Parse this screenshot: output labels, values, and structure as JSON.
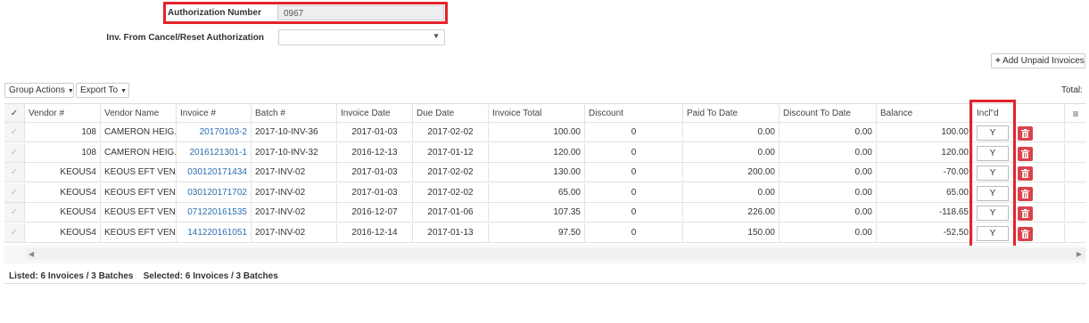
{
  "form": {
    "auth_label": "Authorization Number",
    "auth_value": "0967",
    "inv_cancel_label": "Inv. From Cancel/Reset Authorization",
    "inv_cancel_value": ""
  },
  "toolbar": {
    "add_unpaid_label": "Add Unpaid Invoices",
    "group_actions_label": "Group Actions",
    "export_to_label": "Export To",
    "total_label": "Total:"
  },
  "grid": {
    "columns": [
      "Vendor #",
      "Vendor Name",
      "Invoice #",
      "Batch #",
      "Invoice Date",
      "Due Date",
      "Invoice Total",
      "Discount",
      "Paid To Date",
      "Discount To Date",
      "Balance",
      "Incl\"d"
    ],
    "rows": [
      {
        "vendor": "108",
        "name": "CAMERON HEIG...",
        "invoice": "20170103-2",
        "batch": "2017-10-INV-36",
        "inv_date": "2017-01-03",
        "due_date": "2017-02-02",
        "total": "100.00",
        "discount": "0",
        "paid": "0.00",
        "disc_to_date": "0.00",
        "balance": "100.00",
        "incl": "Y"
      },
      {
        "vendor": "108",
        "name": "CAMERON HEIG...",
        "invoice": "2016121301-1",
        "batch": "2017-10-INV-32",
        "inv_date": "2016-12-13",
        "due_date": "2017-01-12",
        "total": "120.00",
        "discount": "0",
        "paid": "0.00",
        "disc_to_date": "0.00",
        "balance": "120.00",
        "incl": "Y"
      },
      {
        "vendor": "KEOUS4",
        "name": "KEOUS EFT VEN...",
        "invoice": "030120171434",
        "batch": "2017-INV-02",
        "inv_date": "2017-01-03",
        "due_date": "2017-02-02",
        "total": "130.00",
        "discount": "0",
        "paid": "200.00",
        "disc_to_date": "0.00",
        "balance": "-70.00",
        "incl": "Y"
      },
      {
        "vendor": "KEOUS4",
        "name": "KEOUS EFT VEN...",
        "invoice": "030120171702",
        "batch": "2017-INV-02",
        "inv_date": "2017-01-03",
        "due_date": "2017-02-02",
        "total": "65.00",
        "discount": "0",
        "paid": "0.00",
        "disc_to_date": "0.00",
        "balance": "65.00",
        "incl": "Y"
      },
      {
        "vendor": "KEOUS4",
        "name": "KEOUS EFT VEN...",
        "invoice": "071220161535",
        "batch": "2017-INV-02",
        "inv_date": "2016-12-07",
        "due_date": "2017-01-06",
        "total": "107.35",
        "discount": "0",
        "paid": "226.00",
        "disc_to_date": "0.00",
        "balance": "-118.65",
        "incl": "Y"
      },
      {
        "vendor": "KEOUS4",
        "name": "KEOUS EFT VEN...",
        "invoice": "141220161051",
        "batch": "2017-INV-02",
        "inv_date": "2016-12-14",
        "due_date": "2017-01-13",
        "total": "97.50",
        "discount": "0",
        "paid": "150.00",
        "disc_to_date": "0.00",
        "balance": "-52.50",
        "incl": "Y"
      }
    ]
  },
  "footer": {
    "status": "Listed: 6 Invoices / 3 Batches    Selected: 6 Invoices / 3 Batches"
  },
  "icons": {
    "plus": "plus-icon",
    "caret": "caret-down-icon",
    "check": "check-icon",
    "trash": "trash-icon",
    "menu": "menu-icon",
    "scroll_left": "arrow-left-icon",
    "scroll_right": "arrow-right-icon"
  },
  "colors": {
    "highlight": "#e3222b",
    "link": "#2a6fb0",
    "delete": "#d9434b"
  }
}
